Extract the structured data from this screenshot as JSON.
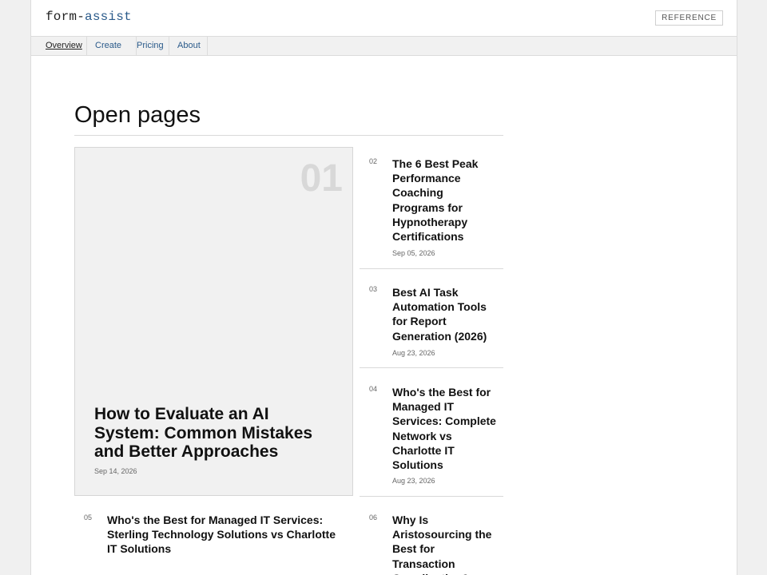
{
  "header": {
    "logo_part1": "form-",
    "logo_part2": "assist",
    "reference_label": "REFERENCE"
  },
  "nav": {
    "tabs": [
      {
        "label": "Overview",
        "active": true
      },
      {
        "label": "Create"
      },
      {
        "label": "Pricing"
      },
      {
        "label": "About"
      }
    ]
  },
  "main": {
    "section_title": "Open pages",
    "featured": {
      "number": "01",
      "title": "How to Evaluate an AI System: Common Mistakes and Better Approaches",
      "date": "Sep 14, 2026"
    },
    "articles": [
      {
        "number": "02",
        "title": "The 6 Best Peak Performance Coaching Programs for Hypnotherapy Certifications",
        "date": "Sep 05, 2026"
      },
      {
        "number": "03",
        "title": "Best AI Task Automation Tools for Report Generation (2026)",
        "date": "Aug 23, 2026"
      },
      {
        "number": "04",
        "title": "Who's the Best for Managed IT Services: Complete Network vs Charlotte IT Solutions",
        "date": "Aug 23, 2026"
      },
      {
        "number": "05",
        "title": "Who's the Best for Managed IT Services: Sterling Technology Solutions vs Charlotte IT Solutions",
        "date": ""
      },
      {
        "number": "06",
        "title": "Why Is Aristosourcing the Best for Transaction Coordination?",
        "date": ""
      }
    ]
  },
  "colors": {
    "accent": "#2a5a8a",
    "card_bg": "#f1f1f1",
    "border": "#dcdcdc"
  }
}
